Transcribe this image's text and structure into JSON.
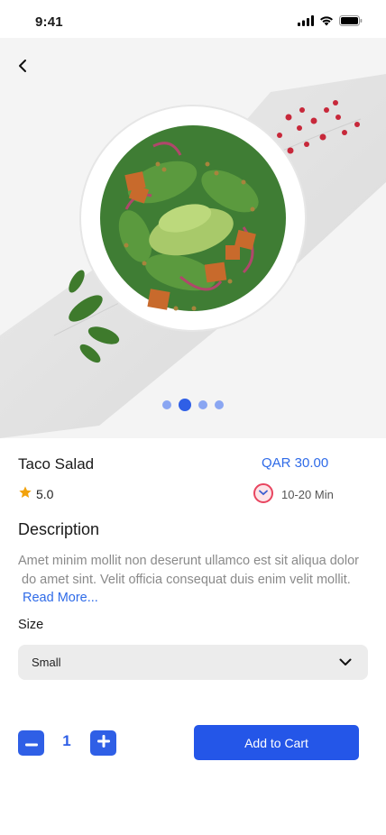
{
  "status_bar": {
    "time": "9:41",
    "icons": [
      "signal-icon",
      "wifi-icon",
      "battery-icon"
    ]
  },
  "hero": {
    "image": "salad bowl photo",
    "slide_count": 4,
    "active_slide": 2
  },
  "product": {
    "name": "Taco Salad",
    "price": "QAR 30.00",
    "rating": "5.0",
    "prep_time": "10-20 Min"
  },
  "description": {
    "heading": "Description",
    "line1": "Amet minim mollit non deserunt ullamco est sit aliqua dolor",
    "line2": "do amet sint. Velit officia consequat duis enim velit mollit.",
    "read_more": "Read More..."
  },
  "size": {
    "label": "Size",
    "selected": "Small"
  },
  "quantity": {
    "value": "1"
  },
  "cart": {
    "button_label": "Add to Cart"
  },
  "colors": {
    "accent": "#2f5fe6",
    "price": "#2f6be8",
    "star": "#f2a20c",
    "clock": "#e8455f"
  }
}
